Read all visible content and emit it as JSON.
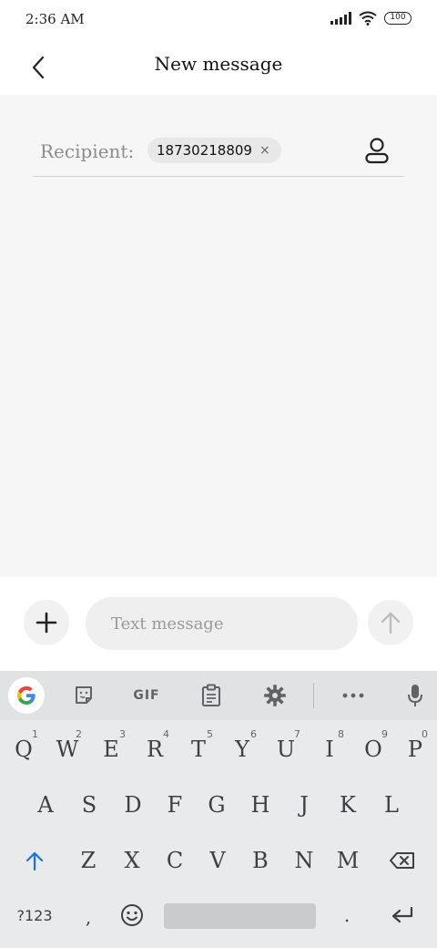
{
  "status_bar": {
    "time": "2:36 AM",
    "battery": "100"
  },
  "header": {
    "title": "New message"
  },
  "recipient": {
    "label": "Recipient:",
    "chip": "18730218809",
    "chip_remove": "×"
  },
  "compose": {
    "placeholder": "Text message"
  },
  "keyboard": {
    "toolbar": {
      "gif": "GIF"
    },
    "row1": [
      {
        "key": "Q",
        "hint": "1"
      },
      {
        "key": "W",
        "hint": "2"
      },
      {
        "key": "E",
        "hint": "3"
      },
      {
        "key": "R",
        "hint": "4"
      },
      {
        "key": "T",
        "hint": "5"
      },
      {
        "key": "Y",
        "hint": "6"
      },
      {
        "key": "U",
        "hint": "7"
      },
      {
        "key": "I",
        "hint": "8"
      },
      {
        "key": "O",
        "hint": "9"
      },
      {
        "key": "P",
        "hint": "0"
      }
    ],
    "row2": [
      "A",
      "S",
      "D",
      "F",
      "G",
      "H",
      "J",
      "K",
      "L"
    ],
    "row3": [
      "Z",
      "X",
      "C",
      "V",
      "B",
      "N",
      "M"
    ],
    "row4": {
      "symbols": "?123",
      "comma": ",",
      "period": "."
    }
  },
  "colors": {
    "accent": "#1a73e8",
    "background": "#f6f6f6",
    "keyboard_bg": "#e9eaec"
  },
  "icons": {
    "back": "chevron-left-icon",
    "contact": "person-icon",
    "add": "plus-icon",
    "send": "arrow-up-icon",
    "google": "google-g-icon",
    "sticker": "sticker-icon",
    "clipboard": "clipboard-icon",
    "settings": "gear-icon",
    "more": "more-horizontal-icon",
    "mic": "microphone-icon",
    "shift": "shift-arrow-icon",
    "backspace": "backspace-icon",
    "emoji": "emoji-icon",
    "enter": "enter-icon"
  }
}
